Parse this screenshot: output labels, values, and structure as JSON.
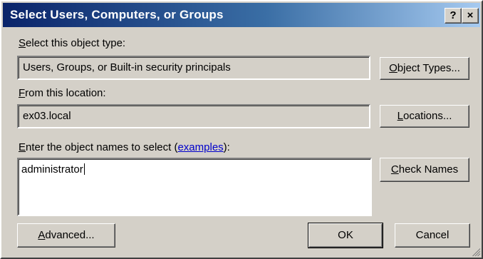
{
  "window": {
    "title": "Select Users, Computers, or Groups",
    "help_button": "?",
    "close_button": "×"
  },
  "object_type": {
    "label_prefix": "S",
    "label_rest": "elect this object type:",
    "value": "Users, Groups, or Built-in security principals",
    "button_prefix": "O",
    "button_rest": "bject Types..."
  },
  "location": {
    "label_prefix": "F",
    "label_rest": "rom this location:",
    "value": "ex03.local",
    "button_prefix": "L",
    "button_rest": "ocations..."
  },
  "object_names": {
    "label_prefix": "E",
    "label_rest": "nter the object names to select (",
    "link_text": "examples",
    "label_suffix": "):",
    "value": "administrator",
    "button_prefix": "C",
    "button_rest": "heck Names"
  },
  "footer": {
    "advanced_prefix": "A",
    "advanced_rest": "dvanced...",
    "ok_label": "OK",
    "cancel_label": "Cancel"
  },
  "colors": {
    "dialog_bg": "#d4d0c8",
    "title_start": "#0a246a",
    "title_end": "#a6caf0",
    "link": "#0000cc"
  }
}
